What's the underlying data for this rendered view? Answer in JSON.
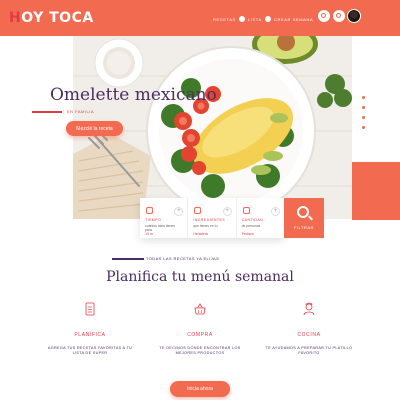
{
  "brand": {
    "logo_text": "HOY TOCA",
    "accent": "#f26a4f",
    "title_color": "#4b2c5e",
    "tag_color": "#e63946"
  },
  "nav": {
    "items": [
      {
        "label": "Recetas"
      },
      {
        "label": "Lista"
      },
      {
        "label": "Crear Semana"
      }
    ],
    "icons": [
      "search-icon",
      "user-icon"
    ]
  },
  "hero": {
    "title": "Omelette mexicano",
    "tag": "En familia",
    "cta_label": "Mezclé la receta",
    "slide_count": 4,
    "active_slide": 4
  },
  "filters": {
    "items": [
      {
        "label": "Tiempo",
        "sub": "cuantos mins tienes para",
        "value": "10 m"
      },
      {
        "label": "Ingredientes",
        "sub": "que tienes en tu",
        "value": "Heladera"
      },
      {
        "label": "Cantidad",
        "sub": "de personas",
        "value": "Pedazo"
      }
    ],
    "button_label": "Filtrar"
  },
  "section": {
    "tag": "Todas las recetas ya elijas",
    "title": "Planifica tu menú semanal",
    "features": [
      {
        "title": "Planifica",
        "desc": "Agrega tus recetas favoritas a tu lista de super",
        "icon": "list-icon"
      },
      {
        "title": "Compra",
        "desc": "Te decimos dónde encontrar los mejores productos",
        "icon": "basket-icon"
      },
      {
        "title": "Cocina",
        "desc": "Te ayudamos a preparar tu platillo favorito",
        "icon": "chef-icon"
      }
    ],
    "cta_label": "Inicia ahora"
  }
}
